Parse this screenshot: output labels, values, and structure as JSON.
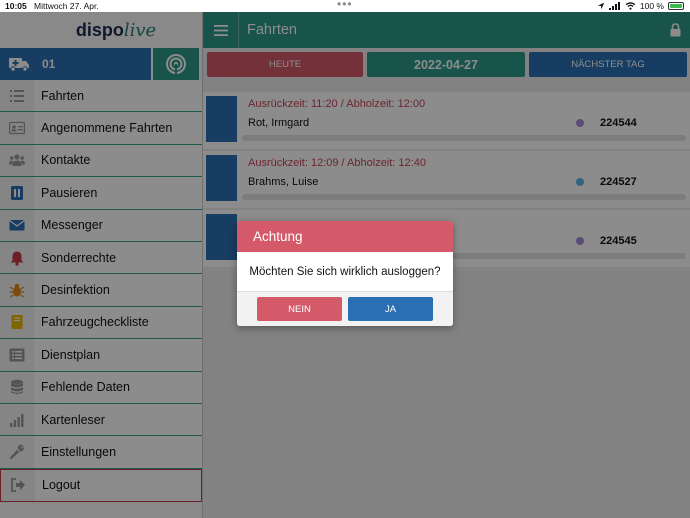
{
  "status_bar": {
    "time": "10:05",
    "date": "Mittwoch 27. Apr.",
    "battery": "100 %"
  },
  "app": {
    "logo_a": "dispo",
    "logo_b": "live"
  },
  "vehicle": {
    "number": "01"
  },
  "sidebar": {
    "items": [
      {
        "label": "Fahrten",
        "icon": "list-icon",
        "color": "#9a9a9a"
      },
      {
        "label": "Angenommene Fahrten",
        "icon": "id-card-icon",
        "color": "#9a9a9a"
      },
      {
        "label": "Kontakte",
        "icon": "users-icon",
        "color": "#9a9a9a"
      },
      {
        "label": "Pausieren",
        "icon": "pause-icon",
        "color": "#2a6fb4"
      },
      {
        "label": "Messenger",
        "icon": "envelope-icon",
        "color": "#2a6fb4"
      },
      {
        "label": "Sonderrechte",
        "icon": "bell-icon",
        "color": "#c53a44"
      },
      {
        "label": "Desinfektion",
        "icon": "bug-icon",
        "color": "#e08a1a"
      },
      {
        "label": "Fahrzeugcheckliste",
        "icon": "book-icon",
        "color": "#e6b800"
      },
      {
        "label": "Dienstplan",
        "icon": "list-alt-icon",
        "color": "#9a9a9a"
      },
      {
        "label": "Fehlende Daten",
        "icon": "database-icon",
        "color": "#9a9a9a"
      },
      {
        "label": "Kartenleser",
        "icon": "signal-bars-icon",
        "color": "#9a9a9a"
      },
      {
        "label": "Einstellungen",
        "icon": "wrench-icon",
        "color": "#9a9a9a"
      },
      {
        "label": "Logout",
        "icon": "sign-out-icon",
        "color": "#9a9a9a"
      }
    ]
  },
  "header": {
    "title": "Fahrten"
  },
  "day_nav": {
    "today": "HEUTE",
    "date": "2022-04-27",
    "next": "NÄCHSTER TAG"
  },
  "rides": [
    {
      "time": "Ausrückzeit: 11:20 / Abholzeit: 12:00",
      "name": "Rot, Irmgard",
      "dot": "#a78bd6",
      "number": "224544"
    },
    {
      "time": "Ausrückzeit: 12:09 / Abholzeit: 12:40",
      "name": "Brahms, Luise",
      "dot": "#5ab8e8",
      "number": "224527"
    },
    {
      "time": "",
      "name": "",
      "dot": "#a78bd6",
      "number": "224545"
    }
  ],
  "dialog": {
    "title": "Achtung",
    "message": "Möchten Sie sich wirklich ausloggen?",
    "no": "NEIN",
    "yes": "JA"
  }
}
